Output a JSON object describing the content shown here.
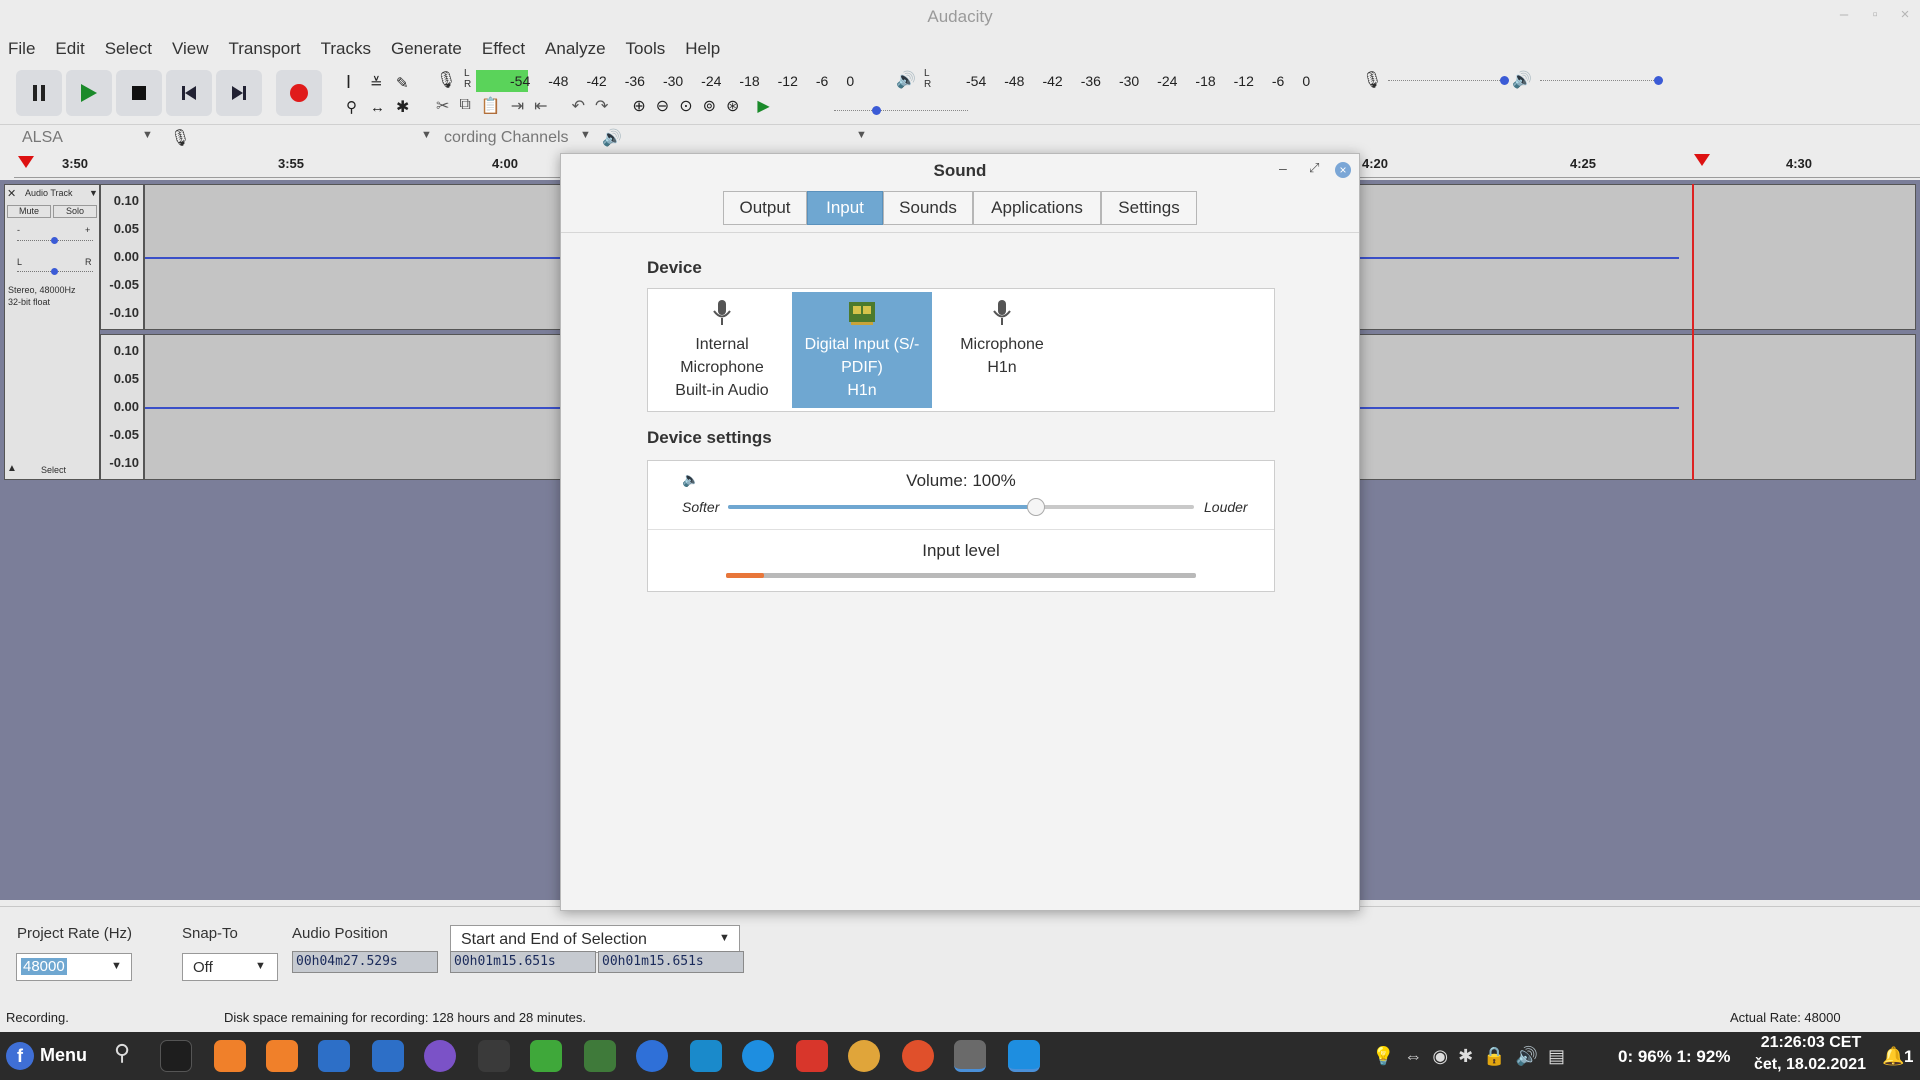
{
  "window": {
    "title": "Audacity"
  },
  "menu": [
    "File",
    "Edit",
    "Select",
    "View",
    "Transport",
    "Tracks",
    "Generate",
    "Effect",
    "Analyze",
    "Tools",
    "Help"
  ],
  "meters": {
    "rec_ticks": [
      "-54",
      "-48",
      "-42",
      "-36",
      "-30",
      "-24",
      "-18",
      "-12",
      "-6",
      "0"
    ],
    "play_ticks": [
      "-54",
      "-48",
      "-42",
      "-36",
      "-30",
      "-24",
      "-18",
      "-12",
      "-6",
      "0"
    ],
    "lr_l": "L",
    "lr_r": "R"
  },
  "device_toolbar": {
    "host": "ALSA",
    "channels": "cording Channels"
  },
  "ruler": {
    "ticks": [
      "3:50",
      "3:55",
      "4:00",
      "4:20",
      "4:25",
      "4:30"
    ]
  },
  "track": {
    "name": "Audio Track",
    "mute": "Mute",
    "solo": "Solo",
    "info1": "Stereo, 48000Hz",
    "info2": "32-bit float",
    "select": "Select",
    "pan_l": "L",
    "pan_r": "R",
    "gain_minus": "-",
    "gain_plus": "+",
    "scale": [
      "0.10",
      "0.05",
      "0.00",
      "-0.05",
      "-0.10"
    ]
  },
  "bottom": {
    "rate_label": "Project Rate (Hz)",
    "rate_value": "48000",
    "snap_label": "Snap-To",
    "snap_value": "Off",
    "pos_label": "Audio Position",
    "pos_value": "00h04m27.529s",
    "sel_mode": "Start and End of Selection",
    "sel_start": "00h01m15.651s",
    "sel_end": "00h01m15.651s"
  },
  "status": {
    "left": "Recording.",
    "middle": "Disk space remaining for recording: 128 hours and 28 minutes.",
    "right": "Actual Rate: 48000"
  },
  "taskbar": {
    "menu": "Menu",
    "battery": "0: 96%  1: 92%",
    "time": "21:26:03 CET",
    "date": "čet, 18.02.2021",
    "notif": "1"
  },
  "dialog": {
    "title": "Sound",
    "tabs": [
      "Output",
      "Input",
      "Sounds",
      "Applications",
      "Settings"
    ],
    "active_tab": 1,
    "device_header": "Device",
    "devices": [
      {
        "line1": "Internal",
        "line2": "Microphone",
        "line3": "Built-in Audio",
        "selected": false
      },
      {
        "line1": "Digital Input (S/-",
        "line2": "PDIF)",
        "line3": "H1n",
        "selected": true
      },
      {
        "line1": "Microphone",
        "line2": "H1n",
        "line3": "",
        "selected": false
      }
    ],
    "settings_header": "Device settings",
    "volume_label": "Volume: 100%",
    "softer": "Softer",
    "louder": "Louder",
    "volume_fraction": 0.66,
    "input_level_label": "Input level",
    "input_level_fraction": 0.08
  }
}
